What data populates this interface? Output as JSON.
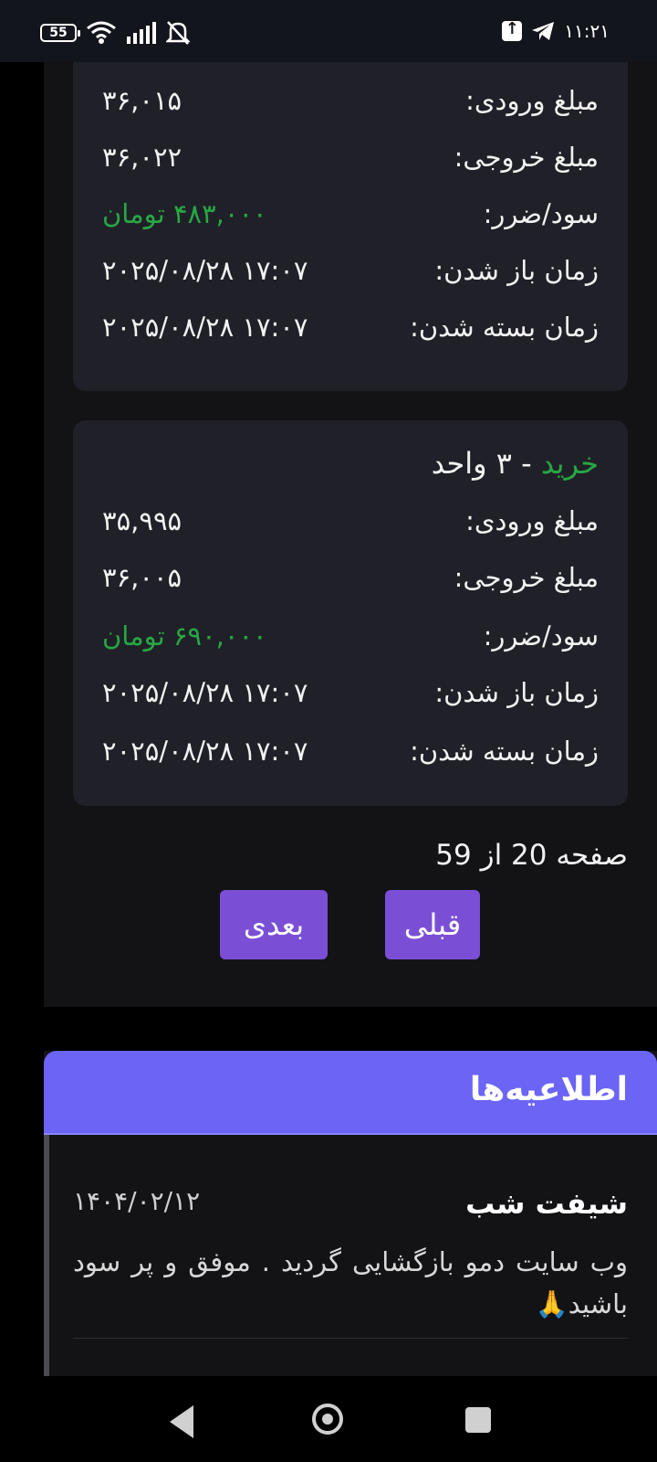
{
  "status_bar": {
    "battery": "55",
    "time": "۱۱:۲۱"
  },
  "trades": [
    {
      "title_type": "",
      "title_rest": "",
      "entry_label": "مبلغ ورودی:",
      "entry_value": "۳۶,۰۱۵",
      "exit_label": "مبلغ خروجی:",
      "exit_value": "۳۶,۰۲۲",
      "pnl_label": "سود/ضرر:",
      "pnl_value": "۴۸۳,۰۰۰ تومان",
      "open_label": "زمان باز شدن:",
      "open_value": "۲۰۲۵/۰۸/۲۸ ۱۷:۰۷",
      "close_label": "زمان بسته شدن:",
      "close_value": "۲۰۲۵/۰۸/۲۸ ۱۷:۰۷"
    },
    {
      "title_type": "خرید",
      "title_rest": " - ۳ واحد",
      "entry_label": "مبلغ ورودی:",
      "entry_value": "۳۵,۹۹۵",
      "exit_label": "مبلغ خروجی:",
      "exit_value": "۳۶,۰۰۵",
      "pnl_label": "سود/ضرر:",
      "pnl_value": "۶۹۰,۰۰۰ تومان",
      "open_label": "زمان باز شدن:",
      "open_value": "۲۰۲۵/۰۸/۲۸ ۱۷:۰۷",
      "close_label": "زمان بسته شدن:",
      "close_value": "۲۰۲۵/۰۸/۲۸ ۱۷:۰۷"
    }
  ],
  "pagination": {
    "info": "صفحه 20 از 59",
    "next_label": "بعدی",
    "prev_label": "قبلی"
  },
  "notices": {
    "title": "اطلاعیه‌ها",
    "items": [
      {
        "title": "شیفت شب",
        "date": "۱۴۰۴/۰۲/۱۲",
        "body": "وب سایت دمو بازگشایی گردید . موفق و پر سود باشید🙏"
      }
    ]
  },
  "colors": {
    "profit": "#27a844",
    "button": "#7a4fd6",
    "notices_header": "#6b64f5"
  },
  "icons": [
    "battery-icon",
    "wifi-icon",
    "signal-icon",
    "bell-off-icon",
    "upload-icon",
    "telegram-icon",
    "back-icon",
    "home-icon",
    "recents-icon"
  ]
}
